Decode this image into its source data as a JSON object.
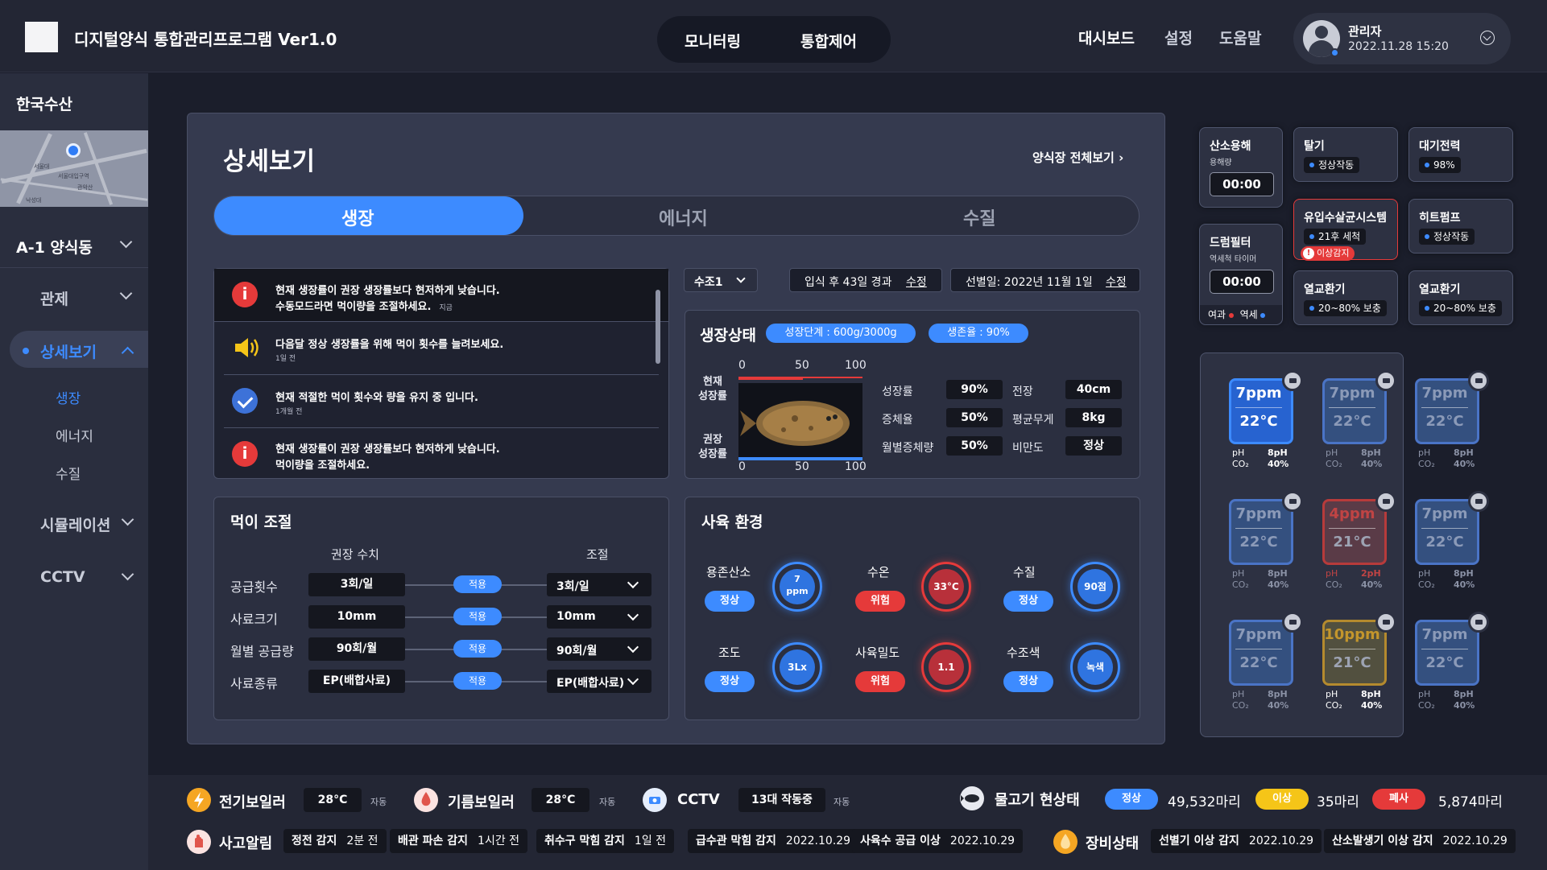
{
  "header": {
    "title": "디지털양식 통합관리프로그램 Ver1.0",
    "nav_center": [
      "모니터링",
      "통합제어"
    ],
    "nav_right": [
      "대시보드",
      "설정",
      "도움말"
    ],
    "user": {
      "name": "관리자",
      "datetime": "2022.11.28 15:20"
    }
  },
  "sidebar": {
    "company": "한국수산",
    "map_labels": [
      "서울대",
      "서울대입구역",
      "관악산",
      "낙성대"
    ],
    "facility": "A-1 양식동",
    "items": [
      {
        "label": "관제"
      },
      {
        "label": "상세보기",
        "active": true,
        "sub": [
          "생장",
          "에너지",
          "수질"
        ]
      },
      {
        "label": "시뮬레이션"
      },
      {
        "label": "CCTV"
      }
    ]
  },
  "detail": {
    "title": "상세보기",
    "farm_link": "양식장 전체보기",
    "tabs": [
      "생장",
      "에너지",
      "수질"
    ],
    "alerts": [
      {
        "icon": "warning",
        "l1": "현재 생장률이 권장 생장률보다 현저하게 낮습니다.",
        "l2": "수동모드라면 먹이량을 조절하세요.",
        "time": "지금"
      },
      {
        "icon": "speaker",
        "l1": "다음달 정상 생장률을 위해 먹이 횟수를 늘려보세요.",
        "time": "1일 전"
      },
      {
        "icon": "check",
        "l1": "현재 적절한 먹이 횟수와 량을 유지 중 입니다.",
        "time": "1개월 전"
      },
      {
        "icon": "warning",
        "l1": "현재 생장률이 권장 생장률보다 현저하게 낮습니다.",
        "l2": "먹이량을 조절하세요."
      }
    ],
    "tank_select": "수조1",
    "days_info": "입식 후 43일 경과",
    "ship_info": "선별일: 2022년 11월 1일",
    "edit_label": "수정",
    "growth": {
      "title": "생장상태",
      "stage": "성장단계 : 600g/3000g",
      "survival": "생존율 : 90%",
      "current_label": "현재\n성장률",
      "recommend_label": "권장\n성장률",
      "scale": [
        "0",
        "50",
        "100"
      ],
      "current_pct": 52,
      "recommend_pct": 100,
      "stats": [
        {
          "label": "성장률",
          "value": "90%"
        },
        {
          "label": "증체율",
          "value": "50%"
        },
        {
          "label": "월별증체량",
          "value": "50%"
        }
      ],
      "stats2": [
        {
          "label": "전장",
          "value": "40cm"
        },
        {
          "label": "평균무게",
          "value": "8kg"
        },
        {
          "label": "비만도",
          "value": "정상"
        }
      ]
    },
    "feed": {
      "title": "먹이 조절",
      "col_recommend": "권장 수치",
      "col_adjust": "조절",
      "apply_label": "적용",
      "rows": [
        {
          "label": "공급횟수",
          "value": "3회/일",
          "adjust": "3회/일"
        },
        {
          "label": "사료크기",
          "value": "10mm",
          "adjust": "10mm"
        },
        {
          "label": "월별 공급량",
          "value": "90회/월",
          "adjust": "90회/월"
        },
        {
          "label": "사료종류",
          "value": "EP(배합사료)",
          "adjust": "EP(배합사료)"
        }
      ]
    },
    "env": {
      "title": "사육 환경",
      "items": [
        {
          "label": "용존산소",
          "status": "정상",
          "value": "7\nppm",
          "level": "ok"
        },
        {
          "label": "수온",
          "status": "위험",
          "value": "33°C",
          "level": "bad"
        },
        {
          "label": "수질",
          "status": "정상",
          "value": "90점",
          "level": "ok"
        },
        {
          "label": "조도",
          "status": "정상",
          "value": "3Lx",
          "level": "ok"
        },
        {
          "label": "사육밀도",
          "status": "위험",
          "value": "1.1",
          "level": "bad"
        },
        {
          "label": "수조색",
          "status": "정상",
          "value": "녹색",
          "level": "ok"
        }
      ]
    }
  },
  "equipment": {
    "o2": {
      "title": "산소용해",
      "sub": "용해량",
      "timer": "00:00"
    },
    "degas": {
      "title": "탈기",
      "status": "정상작동"
    },
    "power": {
      "title": "대기전력",
      "status": "98%"
    },
    "drum": {
      "title": "드럼필터",
      "sub": "역세척 타이머",
      "timer": "00:00",
      "legend1": "여과",
      "legend2": "역세"
    },
    "uv": {
      "title": "유입수살균시스템",
      "status": "21후 세척",
      "warn": "이상감지"
    },
    "heatpump": {
      "title": "히트펌프",
      "status": "정상작동"
    },
    "hx1": {
      "title": "열교환기",
      "status": "20~80% 보충"
    },
    "hx2": {
      "title": "열교환기",
      "status": "20~80% 보충"
    }
  },
  "tanks": [
    {
      "o2": "7ppm",
      "temp": "22°C",
      "ph": "8pH",
      "co2": "40%",
      "style": "active"
    },
    {
      "o2": "7ppm",
      "temp": "22°C",
      "ph": "8pH",
      "co2": "40%",
      "style": "dim"
    },
    {
      "o2": "7ppm",
      "temp": "22°C",
      "ph": "8pH",
      "co2": "40%",
      "style": "dim"
    },
    {
      "o2": "7ppm",
      "temp": "22°C",
      "ph": "8pH",
      "co2": "40%",
      "style": "dim"
    },
    {
      "o2": "4ppm",
      "temp": "21°C",
      "ph": "2pH",
      "co2": "40%",
      "style": "red"
    },
    {
      "o2": "7ppm",
      "temp": "22°C",
      "ph": "8pH",
      "co2": "40%",
      "style": "dim"
    },
    {
      "o2": "7ppm",
      "temp": "22°C",
      "ph": "8pH",
      "co2": "40%",
      "style": "dim"
    },
    {
      "o2": "10ppm",
      "temp": "21°C",
      "ph": "8pH",
      "co2": "40%",
      "style": "gold"
    },
    {
      "o2": "7ppm",
      "temp": "22°C",
      "ph": "8pH",
      "co2": "40%",
      "style": "dim"
    }
  ],
  "tank_labels": {
    "ph": "pH",
    "co2": "CO₂"
  },
  "footer": {
    "boiler_e": {
      "title": "전기보일러",
      "value": "28°C",
      "mode": "자동"
    },
    "boiler_o": {
      "title": "기름보일러",
      "value": "28°C",
      "mode": "자동"
    },
    "cctv": {
      "title": "CCTV",
      "value": "13대 작동중",
      "mode": "자동"
    },
    "fish": {
      "title": "물고기 현상태",
      "normal": "정상",
      "normal_count": "49,532마리",
      "abnormal": "이상",
      "abnormal_count": "35마리",
      "dead": "폐사",
      "dead_count": "5,874마리"
    },
    "accident_title": "사고알림",
    "accidents": [
      {
        "name": "정전 감지",
        "time": "2분 전"
      },
      {
        "name": "배관 파손 감지",
        "time": "1시간 전"
      },
      {
        "name": "취수구 막힘 감지",
        "time": "1일 전"
      },
      {
        "name": "급수관 막힘 감지",
        "time": "2022.10.29"
      },
      {
        "name": "사육수 공급 이상",
        "time": "2022.10.29"
      }
    ],
    "equip_title": "장비상태",
    "equips": [
      {
        "name": "선별기 이상 감지",
        "time": "2022.10.29"
      },
      {
        "name": "산소발생기 이상 감지",
        "time": "2022.10.29"
      }
    ]
  },
  "colors": {
    "accent": "#3d8bff",
    "danger": "#e53a3a",
    "warning": "#f5c518",
    "bg": "#1b1e2b",
    "panel": "#353a4f"
  }
}
